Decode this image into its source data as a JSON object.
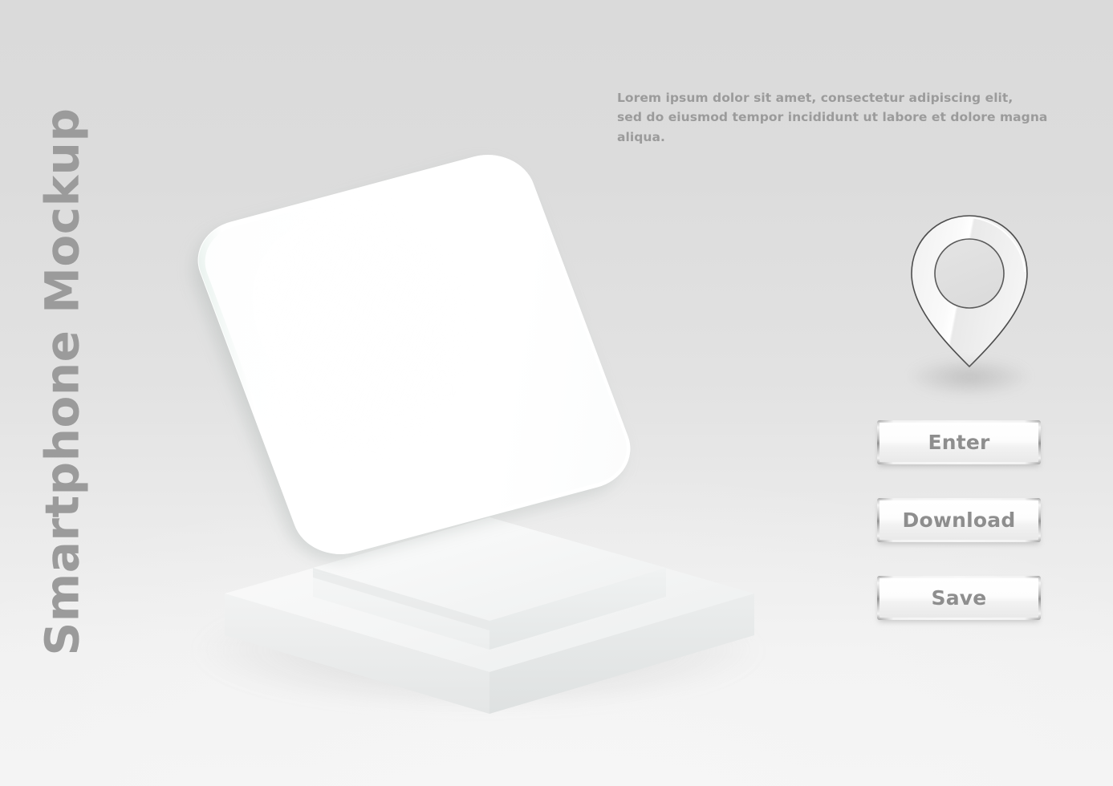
{
  "page": {
    "background_top_color": "#dadada",
    "background_bottom_color": "#f3f3f3",
    "text_color": "#9b9b9b"
  },
  "title": {
    "text": "Smartphone Mockup",
    "orientation": "vertical-bottom-to-top",
    "color": "#9b9b9b"
  },
  "lorem": {
    "line1": "Lorem ipsum dolor sit amet, consectetur adipiscing elit,",
    "line2": "sed do eiusmod tempor incididunt ut labore et dolore magna aliqua.",
    "color": "#9b9b9b"
  },
  "mockup": {
    "device_label": "smartphone-mockup",
    "screen_color": "#ffffff",
    "body_edge_color": "#e5eeea",
    "podium_label": "display-podium",
    "podium_color": "#f2f3f3"
  },
  "pin": {
    "icon": "map-pin-icon",
    "outline_color": "#555555",
    "fill_color": "#f5f5f5"
  },
  "buttons": [
    {
      "label": "Enter",
      "name": "enter-button"
    },
    {
      "label": "Download",
      "name": "download-button"
    },
    {
      "label": "Save",
      "name": "save-button"
    }
  ]
}
